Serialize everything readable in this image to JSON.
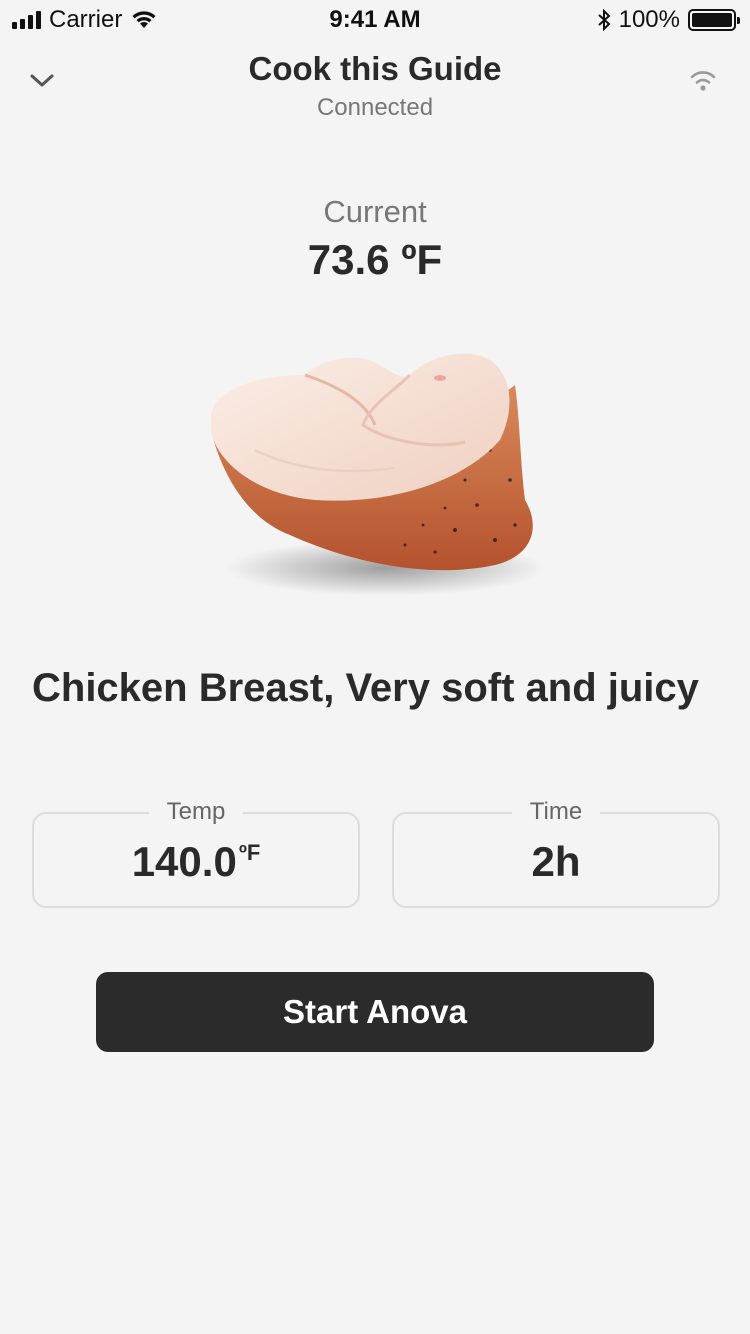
{
  "status_bar": {
    "carrier": "Carrier",
    "time": "9:41 AM",
    "battery": "100%",
    "battery_level": 1.0
  },
  "header": {
    "title": "Cook this Guide",
    "subtitle": "Connected",
    "back_icon": "chevron-down-icon",
    "connection_icon": "wifi-icon"
  },
  "current": {
    "label": "Current",
    "value": "73.6 ºF"
  },
  "recipe": {
    "image": "chicken-breast-image",
    "title": "Chicken Breast, Very soft and juicy"
  },
  "settings": {
    "temp_label": "Temp",
    "temp_value": "140.0",
    "temp_unit": "ºF",
    "time_label": "Time",
    "time_value": "2h"
  },
  "actions": {
    "start_label": "Start Anova"
  },
  "colors": {
    "background": "#f4f4f4",
    "button": "#2b2b2b",
    "text": "#2a2a2a",
    "muted": "#777777",
    "border": "#dcdcdc"
  }
}
